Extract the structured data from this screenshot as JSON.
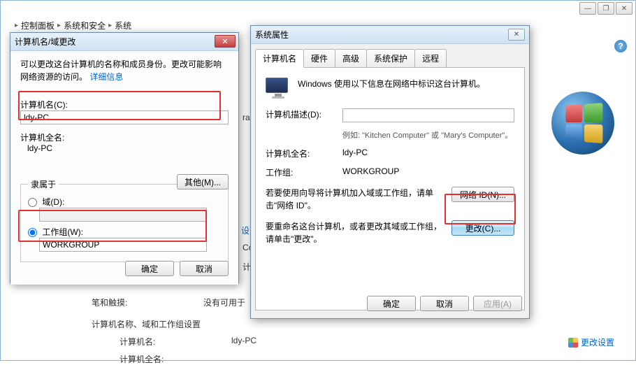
{
  "breadcrumb": {
    "seg1": "控制面板",
    "seg2": "系统和安全",
    "seg3": "系统"
  },
  "dlg1": {
    "title": "计算机名/域更改",
    "intro_a": "可以更改这台计算机的名称和成员身份。更改可能影响网络资源的访问。",
    "details_link": "详细信息",
    "name_label": "计算机名(C):",
    "name_value": "ldy-PC",
    "fullname_label": "计算机全名:",
    "fullname_value": "ldy-PC",
    "other_btn": "其他(M)...",
    "member_legend": "隶属于",
    "domain_label": "域(D):",
    "domain_value": "",
    "workgroup_label": "工作组(W):",
    "workgroup_value": "WORKGROUP",
    "ok": "确定",
    "cancel": "取消"
  },
  "dlg2": {
    "title": "系统属性",
    "tabs": {
      "t1": "计算机名",
      "t2": "硬件",
      "t3": "高级",
      "t4": "系统保护",
      "t5": "远程"
    },
    "intro": "Windows 使用以下信息在网络中标识这台计算机。",
    "desc_label": "计算机描述(D):",
    "desc_value": "",
    "desc_hint": "例如: \"Kitchen Computer\" 或 \"Mary's Computer\"。",
    "fullname_label": "计算机全名:",
    "fullname_value": "ldy-PC",
    "workgroup_label": "工作组:",
    "workgroup_value": "WORKGROUP",
    "netid_text": "若要使用向导将计算机加入域或工作组，请单击\"网络 ID\"。",
    "netid_btn": "网络 ID(N)...",
    "change_text": "要重命名这台计算机，或者更改其域或工作组，请单击\"更改\"。",
    "change_btn": "更改(C)...",
    "ok": "确定",
    "cancel": "取消",
    "apply": "应用(A)"
  },
  "sysinfo": {
    "pen_label": "笔和触摸:",
    "pen_value": "没有可用于",
    "heading": "计算机名称、域和工作组设置",
    "name_label": "计算机名:",
    "name_value": "ldy-PC",
    "fullname_label": "计算机全名:"
  },
  "change_settings": "更改设置",
  "peek": {
    "p1": "ra",
    "p2": "设不",
    "p3": "Cc",
    "p4": "计"
  }
}
